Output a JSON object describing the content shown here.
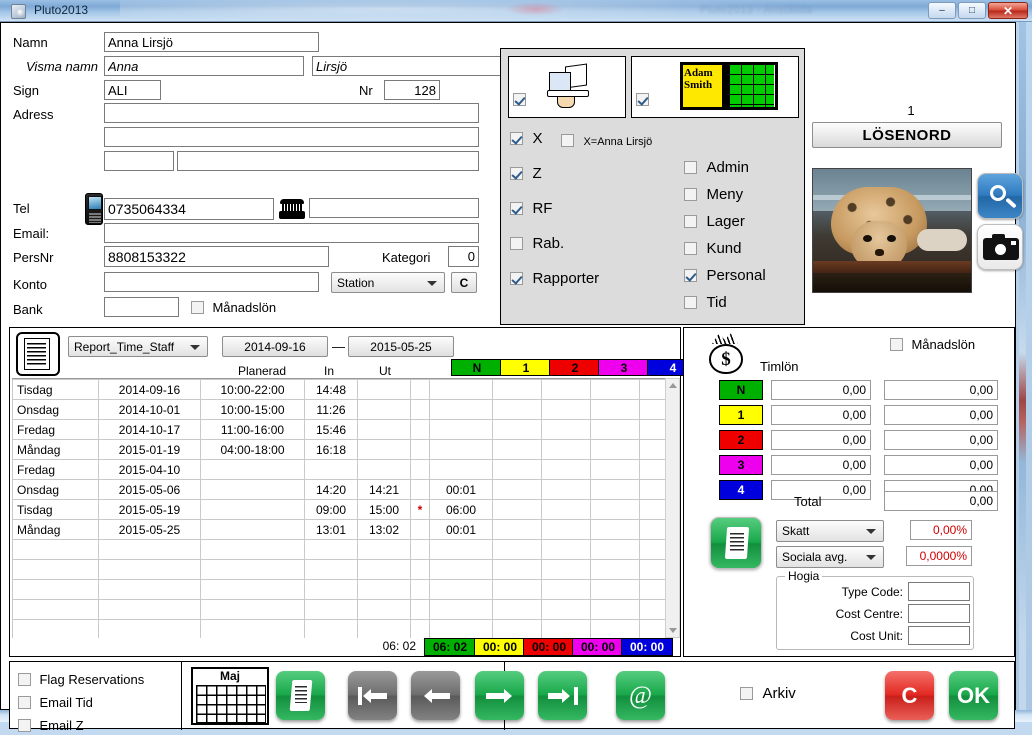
{
  "window": {
    "title": "Pluto2013",
    "ghost_title": "Pluto2013 - Anställda",
    "minimize": "–",
    "maximize": "□",
    "close": "✕"
  },
  "form": {
    "namn_label": "Namn",
    "namn_value": "Anna Lirsjö",
    "visma_label": "Visma namn",
    "visma_first": "Anna",
    "visma_last": "Lirsjö",
    "sign_label": "Sign",
    "sign_value": "ALI",
    "nr_label": "Nr",
    "nr_value": "128",
    "adress_label": "Adress",
    "adress1": "",
    "adress2": "",
    "postnr": "",
    "ort": "",
    "tel_label": "Tel",
    "tel_value": "0735064334",
    "tel2_value": "",
    "email_label": "Email:",
    "email_value": "",
    "persnr_label": "PersNr",
    "persnr_value": "8808153322",
    "kategori_label": "Kategori",
    "kategori_value": "0",
    "konto_label": "Konto",
    "konto_value": "",
    "station_value": "Station",
    "c_button": "C",
    "bank_label": "Bank",
    "bank_value": "",
    "manadslon_label": "Månadslön",
    "manadslon_checked": false
  },
  "permissions": {
    "icon1_checked": true,
    "icon2_checked": true,
    "icon2_text1": "Adam",
    "icon2_text2": "Smith",
    "x_label": "X",
    "x_checked": true,
    "xeq_label": "X=Anna Lirsjö",
    "xeq_checked": false,
    "left_items": [
      {
        "label": "Z",
        "checked": true
      },
      {
        "label": "RF",
        "checked": true
      },
      {
        "label": "Rab.",
        "checked": false
      },
      {
        "label": "Rapporter",
        "checked": true
      }
    ],
    "right_items": [
      {
        "label": "Admin",
        "checked": false
      },
      {
        "label": "Meny",
        "checked": false
      },
      {
        "label": "Lager",
        "checked": false
      },
      {
        "label": "Kund",
        "checked": false
      },
      {
        "label": "Personal",
        "checked": true
      },
      {
        "label": "Tid",
        "checked": false
      }
    ]
  },
  "right_panel": {
    "number": "1",
    "password_button": "LÖSENORD",
    "search_icon": "magnifier-icon",
    "camera_icon": "camera-icon"
  },
  "report": {
    "doc_icon": "document-icon",
    "report_select": "Report_Time_Staff",
    "date_from": "2014-09-16",
    "date_sep": "—",
    "date_to": "2015-05-25",
    "columns": {
      "planerad": "Planerad",
      "in": "In",
      "ut": "Ut"
    },
    "category_headers": [
      {
        "label": "N",
        "bg": "#00b000",
        "fg": "#000000"
      },
      {
        "label": "1",
        "bg": "#ffff00",
        "fg": "#000000"
      },
      {
        "label": "2",
        "bg": "#ee0000",
        "fg": "#000000"
      },
      {
        "label": "3",
        "bg": "#ee00ee",
        "fg": "#000000"
      },
      {
        "label": "4",
        "bg": "#0000dd",
        "fg": "#ffffff"
      }
    ],
    "rows": [
      {
        "day": "Tisdag",
        "date": "2014-09-16",
        "planerad": "10:00-22:00",
        "in": "14:48",
        "ut": "",
        "flag": "",
        "sum": ""
      },
      {
        "day": "Onsdag",
        "date": "2014-10-01",
        "planerad": "10:00-15:00",
        "in": "11:26",
        "ut": "",
        "flag": "",
        "sum": ""
      },
      {
        "day": "Fredag",
        "date": "2014-10-17",
        "planerad": "11:00-16:00",
        "in": "15:46",
        "ut": "",
        "flag": "",
        "sum": ""
      },
      {
        "day": "Måndag",
        "date": "2015-01-19",
        "planerad": "04:00-18:00",
        "in": "16:18",
        "ut": "",
        "flag": "",
        "sum": ""
      },
      {
        "day": "Fredag",
        "date": "2015-04-10",
        "planerad": "",
        "in": "",
        "ut": "",
        "flag": "",
        "sum": ""
      },
      {
        "day": "Onsdag",
        "date": "2015-05-06",
        "planerad": "",
        "in": "14:20",
        "ut": "14:21",
        "flag": "",
        "sum": "00:01"
      },
      {
        "day": "Tisdag",
        "date": "2015-05-19",
        "planerad": "",
        "in": "09:00",
        "ut": "15:00",
        "flag": "*",
        "sum": "06:00"
      },
      {
        "day": "Måndag",
        "date": "2015-05-25",
        "planerad": "",
        "in": "13:01",
        "ut": "13:02",
        "flag": "",
        "sum": "00:01"
      }
    ],
    "empty_row_count": 6,
    "total": "06: 02",
    "category_totals": [
      {
        "label": "06: 02",
        "bg": "#00b000",
        "fg": "#000000"
      },
      {
        "label": "00: 00",
        "bg": "#ffff00",
        "fg": "#000000"
      },
      {
        "label": "00: 00",
        "bg": "#ee0000",
        "fg": "#000000"
      },
      {
        "label": "00: 00",
        "bg": "#ee00ee",
        "fg": "#000000"
      },
      {
        "label": "00: 00",
        "bg": "#0000dd",
        "fg": "#ffffff"
      }
    ]
  },
  "salary": {
    "money_icon": "money-bag-icon",
    "timlon_label": "Timlön",
    "manadslon_label": "Månadslön",
    "manadslon_checked": false,
    "rates": [
      {
        "label": "N",
        "bg": "#00b000",
        "fg": "#000000",
        "v1": "0,00",
        "v2": "0,00"
      },
      {
        "label": "1",
        "bg": "#ffff00",
        "fg": "#000000",
        "v1": "0,00",
        "v2": "0,00"
      },
      {
        "label": "2",
        "bg": "#ee0000",
        "fg": "#000000",
        "v1": "0,00",
        "v2": "0,00"
      },
      {
        "label": "3",
        "bg": "#ee00ee",
        "fg": "#000000",
        "v1": "0,00",
        "v2": "0,00"
      },
      {
        "label": "4",
        "bg": "#0000dd",
        "fg": "#ffffff",
        "v1": "0,00",
        "v2": "0,00"
      }
    ],
    "total_label": "Total",
    "total_value": "0,00",
    "report_icon": "green-report-icon",
    "skatt_select": "Skatt",
    "skatt_pct": "0,00%",
    "sociala_select": "Sociala avg.",
    "sociala_pct": "0,0000%",
    "hogia_legend": "Hogia",
    "type_code_label": "Type Code:",
    "type_code_value": "",
    "cost_centre_label": "Cost Centre:",
    "cost_centre_value": "",
    "cost_unit_label": "Cost Unit:",
    "cost_unit_value": ""
  },
  "bottom": {
    "checks": [
      {
        "label": "Flag Reservations",
        "checked": false
      },
      {
        "label": "Email Tid",
        "checked": false
      },
      {
        "label": "Email Z",
        "checked": false
      }
    ],
    "calendar_month": "Maj",
    "report_icon": "green-report-icon",
    "nav": [
      {
        "name": "first-icon",
        "bg": "#6e6e6e",
        "dir": "first"
      },
      {
        "name": "prev-icon",
        "bg": "#6e6e6e",
        "dir": "prev"
      },
      {
        "name": "next-icon",
        "bg": "#1eb24a",
        "dir": "next"
      },
      {
        "name": "last-icon",
        "bg": "#1eb24a",
        "dir": "last"
      }
    ],
    "at_label": "@",
    "arkiv_label": "Arkiv",
    "arkiv_checked": false,
    "cancel_label": "C",
    "ok_label": "OK",
    "cancel_color": "#e8302a",
    "ok_color": "#1eb24a"
  }
}
